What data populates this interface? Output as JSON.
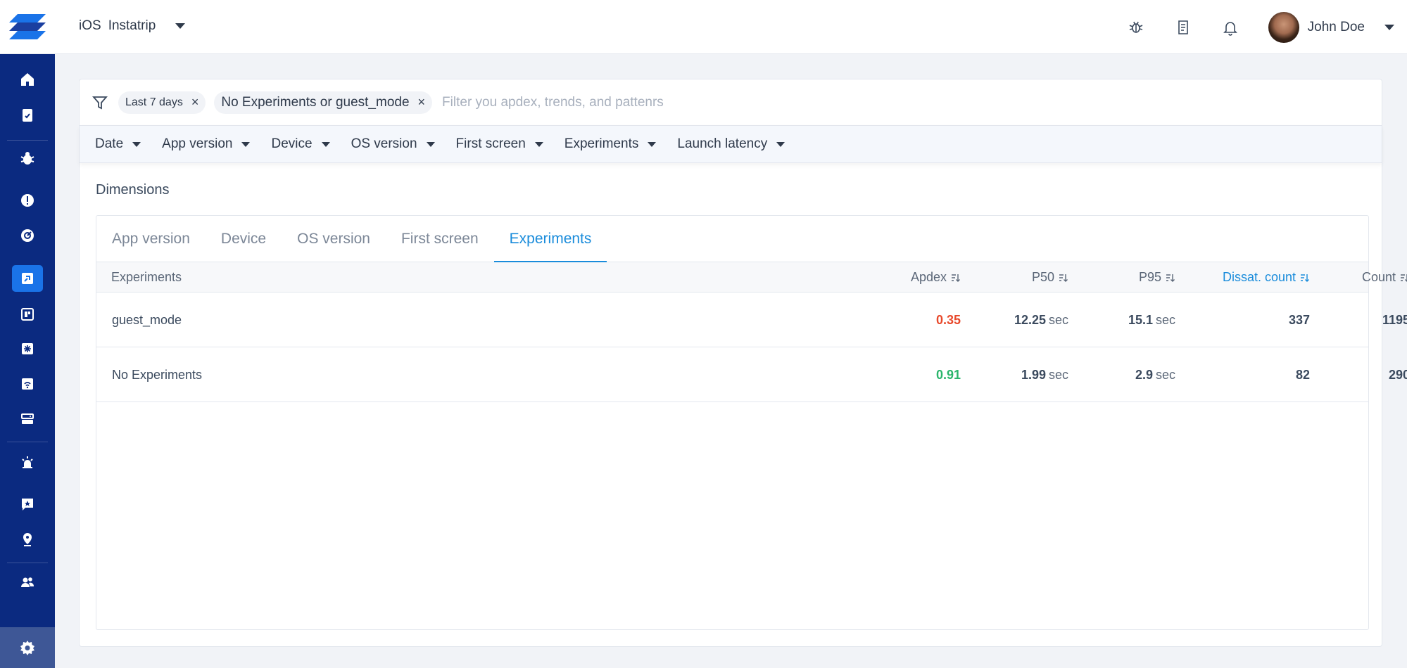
{
  "topbar": {
    "platform": "iOS",
    "app_name": "Instatrip",
    "icons": [
      "bug-icon",
      "notes-icon",
      "bell-icon"
    ],
    "user_name": "John Doe"
  },
  "sidebar": {
    "items": [
      "home-icon",
      "build-icon",
      "bug-icon",
      "alert-icon",
      "dashboard-icon",
      "launch-icon",
      "layout-icon",
      "snowflake-icon",
      "network-icon",
      "devices-icon",
      "alarm-icon",
      "star-feedback-icon",
      "location-icon",
      "users-icon",
      "settings-icon"
    ],
    "active": "launch-icon"
  },
  "filters": {
    "chips": [
      {
        "label": "Last 7 days",
        "remove": "×"
      },
      {
        "label": "No Experiments or guest_mode",
        "remove": "×"
      }
    ],
    "placeholder": "Filter you apdex, trends, and pattenrs",
    "dropdowns": [
      "Date",
      "App version",
      "Device",
      "OS version",
      "First screen",
      "Experiments",
      "Launch latency"
    ]
  },
  "dimensions": {
    "title": "Dimensions",
    "tabs": [
      "App version",
      "Device",
      "OS version",
      "First screen",
      "Experiments"
    ],
    "active_tab": "Experiments",
    "columns": {
      "name": "Experiments",
      "apdex": "Apdex",
      "p50": "P50",
      "p95": "P95",
      "dissat": "Dissat. count",
      "count": "Count"
    },
    "rows": [
      {
        "name": "guest_mode",
        "apdex": "0.35",
        "p50": "12.25",
        "p50_unit": "sec",
        "p95": "15.1",
        "p95_unit": "sec",
        "dissat": "337",
        "count": "1195"
      },
      {
        "name": "No Experiments",
        "apdex": "0.91",
        "p50": "1.99",
        "p50_unit": "sec",
        "p95": "2.9",
        "p95_unit": "sec",
        "dissat": "82",
        "count": "290"
      }
    ]
  },
  "colors": {
    "sidebar": "#0b2a80",
    "accent": "#1a8cdb",
    "apdex_bad": "#e8492b",
    "apdex_good": "#2ab56b"
  }
}
